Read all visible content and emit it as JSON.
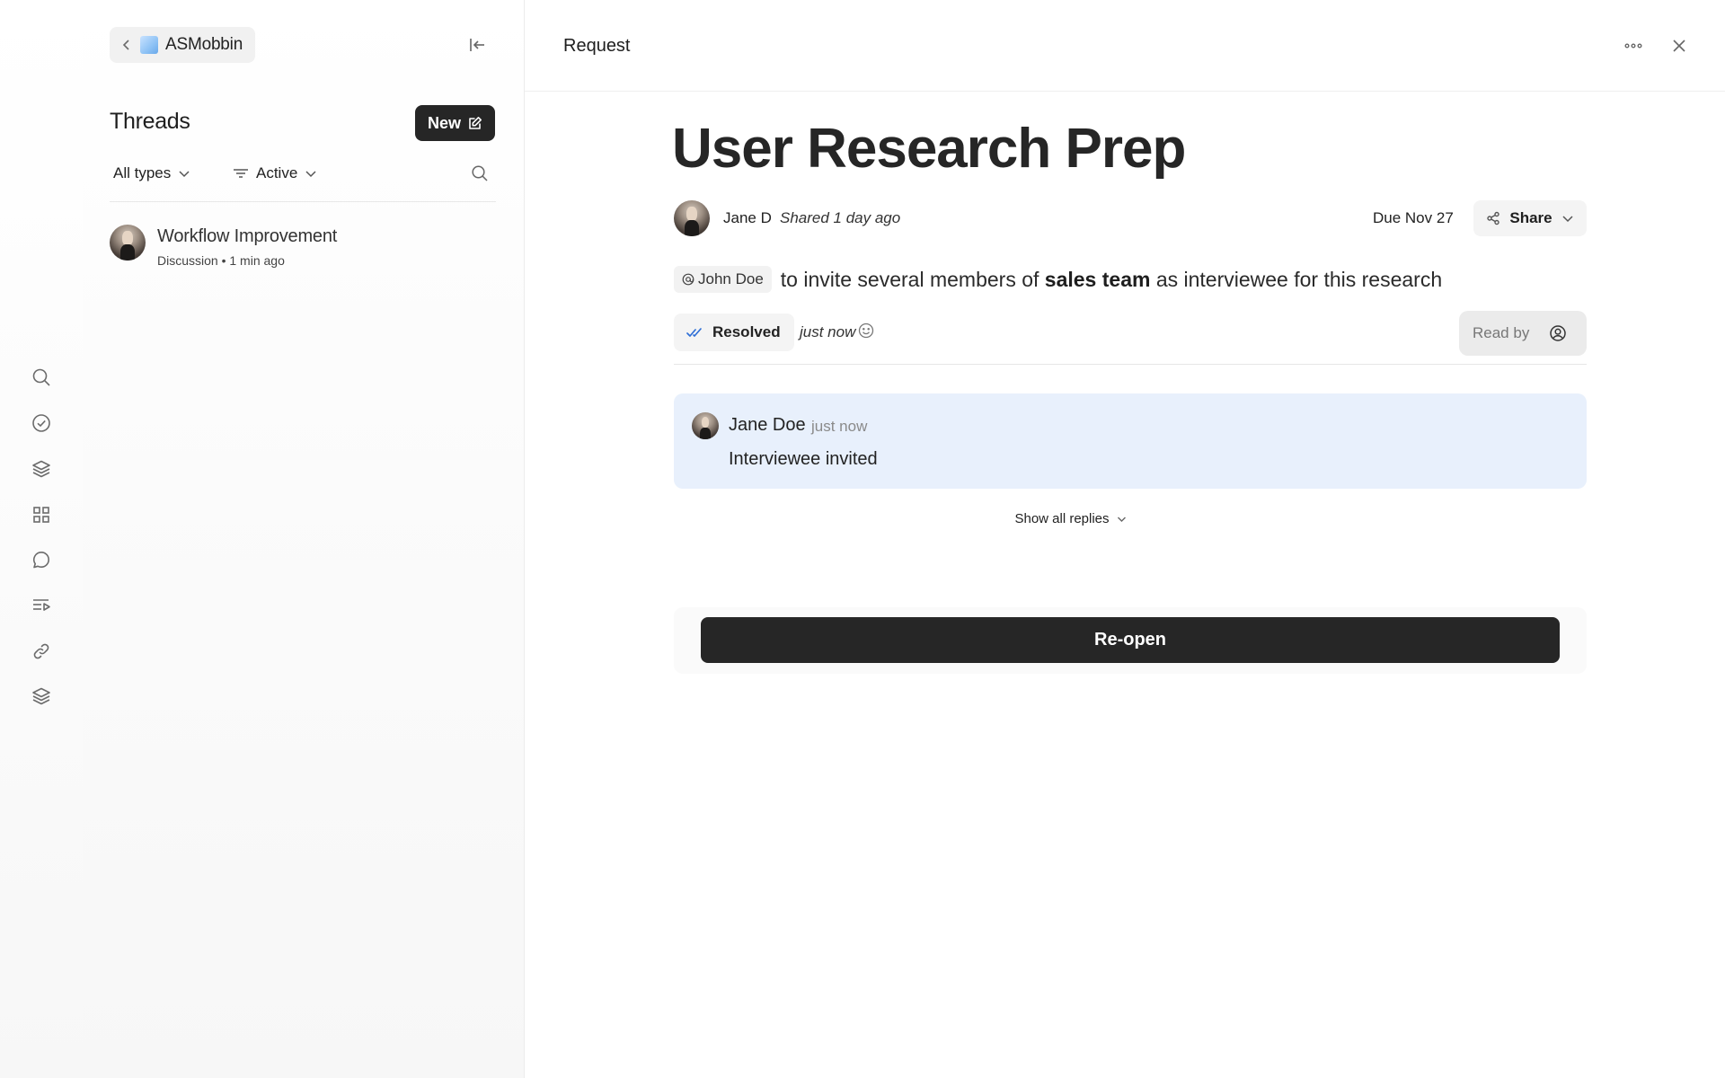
{
  "workspace": {
    "name": "ASMobbin"
  },
  "sidebar": {
    "icons": [
      "search-icon",
      "check-circle-icon",
      "layers-icon",
      "grid-icon",
      "chat-bubble-icon",
      "playlist-icon",
      "link-icon",
      "stack-icon"
    ]
  },
  "threads": {
    "title": "Threads",
    "new_label": "New",
    "filters": {
      "type_label": "All types",
      "status_label": "Active"
    },
    "items": [
      {
        "title": "Workflow Improvement",
        "meta": "Discussion • 1 min ago"
      }
    ]
  },
  "main": {
    "header_title": "Request",
    "doc_title": "User Research Prep",
    "author": "Jane D",
    "shared": "Shared 1 day ago",
    "due": "Due Nov 27",
    "share_label": "Share",
    "request": {
      "mention": "John Doe",
      "text_before": "to invite several members of ",
      "bold": "sales team",
      "text_after": " as interviewee for this research"
    },
    "status": {
      "label": "Resolved",
      "time": "just now",
      "read_by_label": "Read by"
    },
    "reply": {
      "author": "Jane Doe",
      "time": "just now",
      "body": "Interviewee invited"
    },
    "show_replies_label": "Show all replies",
    "reopen_label": "Re-open"
  },
  "colors": {
    "accent_dark": "#262626",
    "reply_bg": "#e8f0fc",
    "check_blue": "#2f6fd6"
  }
}
